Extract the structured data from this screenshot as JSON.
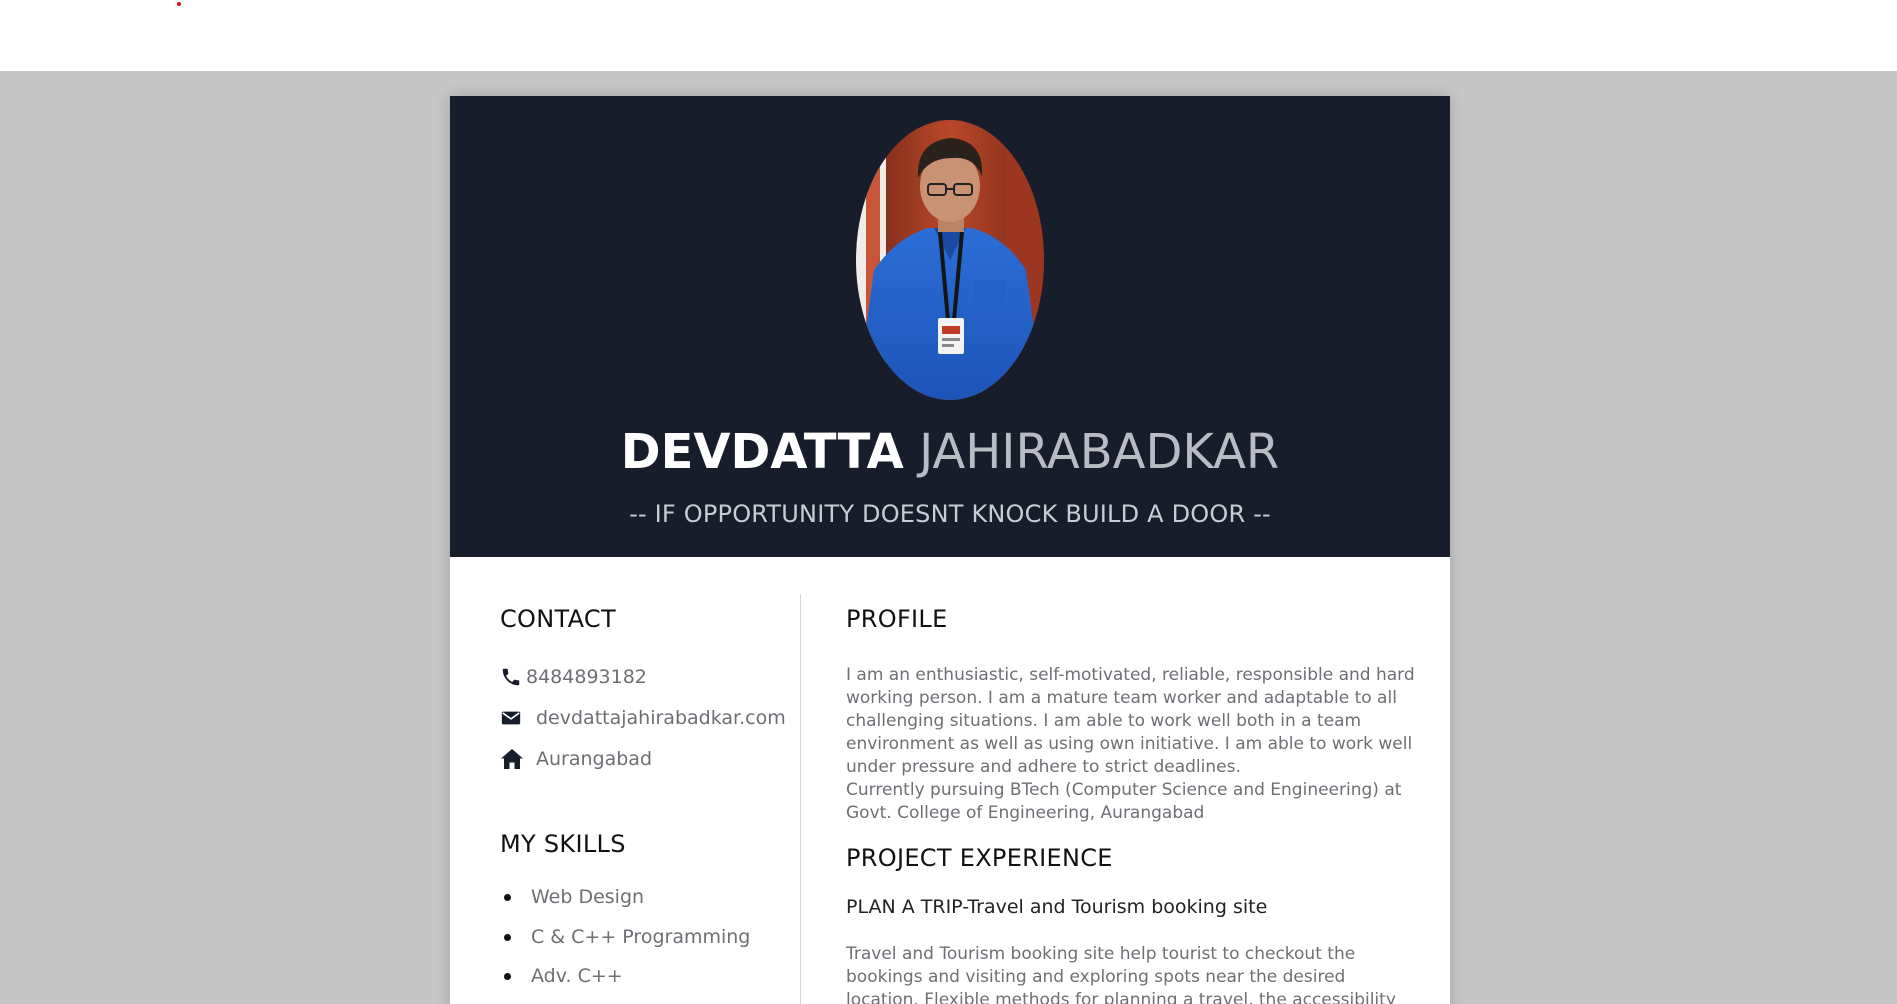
{
  "resume": {
    "first_name": "DEVDATTA",
    "last_name": "JAHIRABADKAR",
    "tagline": "-- IF OPPORTUNITY DOESNT KNOCK BUILD A DOOR --",
    "contact": {
      "title": "CONTACT",
      "phone": "8484893182",
      "email": "devdattajahirabadkar.com",
      "location": "Aurangabad"
    },
    "skills": {
      "title": "MY SKILLS",
      "items": [
        "Web Design",
        "C & C++ Programming",
        "Adv. C++"
      ]
    },
    "profile": {
      "title": "PROFILE",
      "paragraph_1": "I am an enthusiastic, self-motivated, reliable, responsible and hard working person. I am a mature team worker and adaptable to all challenging situations. I am able to work well both in a team environment as well as using own initiative. I am able to work well under pressure and adhere to strict deadlines.",
      "paragraph_2": "Currently pursuing BTech (Computer Science and Engineering) at Govt. College of Engineering, Aurangabad"
    },
    "projects": {
      "title": "PROJECT EXPERIENCE",
      "items": [
        {
          "name": "PLAN A TRIP-Travel and Tourism booking site",
          "description": "Travel and Tourism booking site help tourist to checkout the bookings and visiting and exploring spots near the desired location. Flexible methods for planning a travel, the accessibility and fare depending"
        }
      ]
    }
  },
  "icons": {
    "phone": "phone-icon",
    "email": "envelope-icon",
    "location": "home-icon"
  },
  "colors": {
    "header_bg": "#181d2b",
    "page_bg": "#c6c6c6",
    "text_muted": "#6d6f75",
    "accent_dot": "#e0141e"
  }
}
